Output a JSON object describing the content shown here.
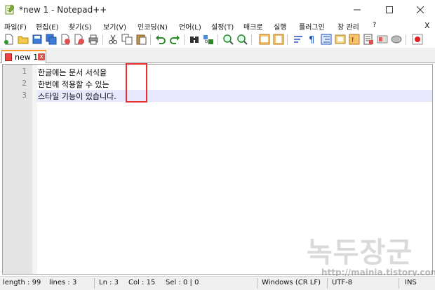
{
  "window": {
    "title": "*new 1 - Notepad++"
  },
  "menu": {
    "items": [
      "파일(F)",
      "편집(E)",
      "찾기(S)",
      "보기(V)",
      "인코딩(N)",
      "언어(L)",
      "설정(T)",
      "매크로",
      "실행",
      "플러그인",
      "창 관리",
      "?"
    ],
    "close_glyph": "X"
  },
  "toolbar": {
    "icons": [
      "new-file-icon",
      "open-file-icon",
      "save-icon",
      "save-all-icon",
      "close-icon",
      "close-all-icon",
      "print-icon",
      "cut-icon",
      "copy-icon",
      "paste-icon",
      "undo-icon",
      "redo-icon",
      "find-icon",
      "replace-icon",
      "zoom-in-icon",
      "zoom-out-icon",
      "sync-vertical-icon",
      "sync-horizontal-icon",
      "word-wrap-icon",
      "show-all-chars-icon",
      "indent-guide-icon",
      "doc-map-icon",
      "function-list-icon",
      "folder-workspace-icon",
      "monitoring-icon",
      "record-macro-icon",
      "stop-macro-icon"
    ]
  },
  "tab": {
    "label": "new 1",
    "close_glyph": "x"
  },
  "editor": {
    "line_numbers": [
      "1",
      "2",
      "3"
    ],
    "lines": [
      "한글에는 문서 서식을",
      "한번에 적용할 수 있는",
      "스타일 기능이 있습니다."
    ]
  },
  "status": {
    "length": "length : 99",
    "lines": "lines : 3",
    "ln": "Ln : 3",
    "col": "Col : 15",
    "sel": "Sel : 0 | 0",
    "eol": "Windows (CR LF)",
    "encoding": "UTF-8",
    "mode": "INS"
  },
  "watermark": {
    "title": "녹두장군",
    "url": "http://mainia.tistory.com"
  },
  "colors": {
    "highlight": "#e8e8ff",
    "annotation": "#e83030",
    "tab_accent": "#f59b2a"
  }
}
